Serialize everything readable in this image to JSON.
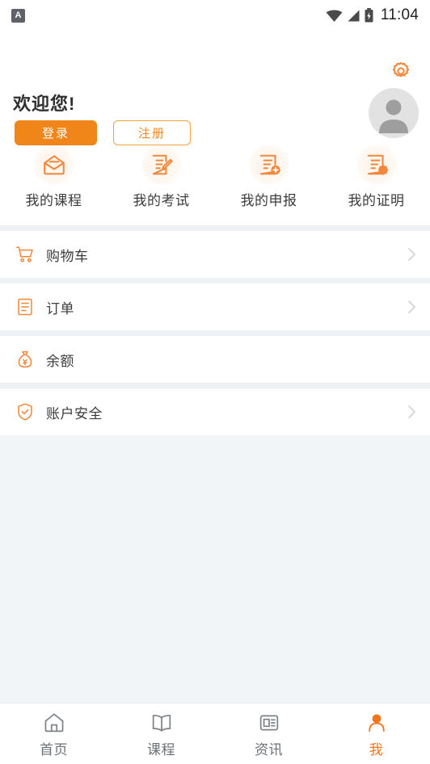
{
  "statusbar": {
    "app_icon": "app-badge-icon",
    "wifi_icon": "wifi-icon",
    "signal_icon": "signal-icon",
    "battery_icon": "battery-icon",
    "time": "11:04"
  },
  "header": {
    "gear_icon": "gear-icon",
    "avatar_icon": "avatar-placeholder-icon",
    "welcome": "欢迎您!",
    "login_label": "登录",
    "register_label": "注册"
  },
  "quick_actions": [
    {
      "label": "我的课程",
      "icon": "envelope-open-icon"
    },
    {
      "label": "我的考试",
      "icon": "document-pencil-icon"
    },
    {
      "label": "我的申报",
      "icon": "document-plus-icon"
    },
    {
      "label": "我的证明",
      "icon": "document-seal-icon"
    }
  ],
  "menu": [
    {
      "label": "购物车",
      "icon": "shopping-cart-icon",
      "chevron": true
    },
    {
      "label": "订单",
      "icon": "order-list-icon",
      "chevron": true
    },
    {
      "label": "余额",
      "icon": "money-bag-icon",
      "chevron": false
    },
    {
      "label": "账户安全",
      "icon": "shield-check-icon",
      "chevron": true
    }
  ],
  "bottom_nav": [
    {
      "label": "首页",
      "icon": "home-icon",
      "active": false
    },
    {
      "label": "课程",
      "icon": "book-icon",
      "active": false
    },
    {
      "label": "资讯",
      "icon": "news-icon",
      "active": false
    },
    {
      "label": "我",
      "icon": "person-icon",
      "active": true
    }
  ],
  "colors": {
    "accent": "#f5731a",
    "button": "#f08519",
    "icon_orange": "#f0873a",
    "page_bg": "#f2f5f8",
    "row_bg": "#ffffff",
    "text": "#3c3c3c",
    "muted": "#6b7075"
  }
}
